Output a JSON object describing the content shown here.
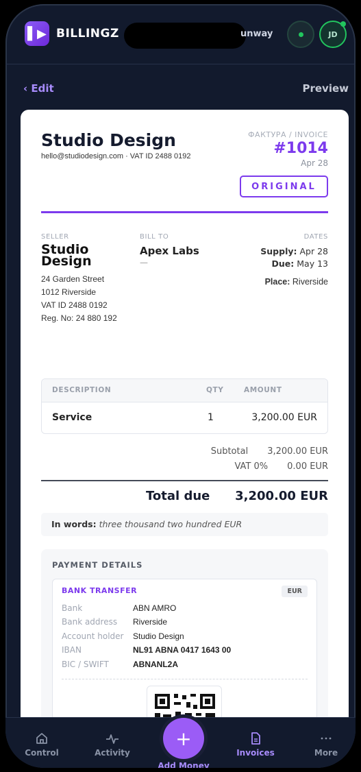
{
  "header": {
    "brand": "BILLINGZ",
    "runway_label": "unway",
    "avatar_initials": "JD",
    "accent": "#7c3aed",
    "status_color": "#22c55e"
  },
  "subbar": {
    "back_label": "‹ Edit",
    "preview_label": "Preview"
  },
  "invoice": {
    "company": "Studio Design",
    "company_sub": "hello@studiodesign.com · VAT ID 2488 0192",
    "label": "ФАКТУРА / INVOICE",
    "number": "#1014",
    "date": "Apr 28",
    "badge": "ORIGINAL",
    "seller": {
      "label": "SELLER",
      "name": "Studio Design",
      "lines": [
        "24 Garden Street",
        "1012 Riverside",
        "VAT ID 2488 0192",
        "Reg. No: 24 880 192"
      ]
    },
    "bill_to": {
      "label": "BILL TO",
      "name": "Apex Labs",
      "detail": "—"
    },
    "dates": {
      "label": "DATES",
      "supply_label": "Supply:",
      "supply": "Apr 28",
      "due_label": "Due:",
      "due": "May 13",
      "place_label": "Place:",
      "place": "Riverside"
    },
    "table": {
      "headers": {
        "description": "DESCRIPTION",
        "qty": "QTY",
        "amount": "AMOUNT"
      },
      "rows": [
        {
          "description": "Service",
          "qty": "1",
          "amount": "3,200.00 EUR"
        }
      ]
    },
    "subtotal_label": "Subtotal",
    "subtotal": "3,200.00 EUR",
    "vat_label": "VAT 0%",
    "vat": "0.00 EUR",
    "total_label": "Total due",
    "total": "3,200.00 EUR",
    "words_label": "In words:",
    "words": "three thousand two hundred EUR",
    "payment": {
      "title": "PAYMENT DETAILS",
      "method": "BANK TRANSFER",
      "currency": "EUR",
      "rows": [
        {
          "k": "Bank",
          "v": "ABN AMRO"
        },
        {
          "k": "Bank address",
          "v": "Riverside"
        },
        {
          "k": "Account holder",
          "v": "Studio Design"
        },
        {
          "k": "IBAN",
          "v": "NL91 ABNA 0417 1643 00"
        },
        {
          "k": "BIC / SWIFT",
          "v": "ABNANL2A"
        }
      ]
    }
  },
  "nav": {
    "items": [
      {
        "label": "Control",
        "icon": "home-icon"
      },
      {
        "label": "Activity",
        "icon": "activity-icon"
      },
      {
        "label": "Invoices",
        "icon": "document-icon"
      },
      {
        "label": "More",
        "icon": "more-icon"
      }
    ],
    "fab_label": "Add Money"
  }
}
